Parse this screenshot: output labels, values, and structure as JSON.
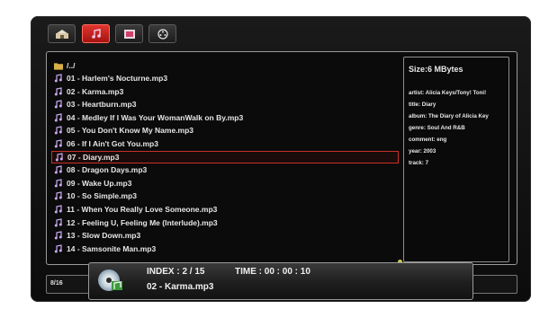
{
  "tabs": [
    {
      "name": "photo-tab",
      "icon": "photo-icon",
      "active": false
    },
    {
      "name": "music-tab",
      "icon": "music-note-icon",
      "active": true
    },
    {
      "name": "video-tab",
      "icon": "film-icon",
      "active": false
    },
    {
      "name": "all-media-tab",
      "icon": "reel-icon",
      "active": false
    }
  ],
  "list": {
    "parent": "/../",
    "items": [
      "01 - Harlem's Nocturne.mp3",
      "02 - Karma.mp3",
      "03 - Heartburn.mp3",
      "04 - Medley If I Was Your WomanWalk on By.mp3",
      "05 - You Don't Know My Name.mp3",
      "06 - If I Ain't Got You.mp3",
      "07 - Diary.mp3",
      "08 - Dragon Days.mp3",
      "09 - Wake Up.mp3",
      "10 - So Simple.mp3",
      "11 - When You Really Love Someone.mp3",
      "12 - Feeling U, Feeling Me (Interlude).mp3",
      "13 - Slow Down.mp3",
      "14 - Samsonite Man.mp3"
    ],
    "selected_index": 6
  },
  "info": {
    "size": "Size:6 MBytes",
    "artist": "artist: Alicia Keys/Tony! Toni!",
    "title": "title: Diary",
    "album": "album: The Diary of Alicia Key",
    "genre": "genre: Soul And R&B",
    "comment": "comment: eng",
    "year": "year: 2003",
    "track": "track: 7"
  },
  "footer": {
    "count": "8/16"
  },
  "now_playing": {
    "index": "INDEX :  2 / 15",
    "time": "TIME :  00 : 00 : 10",
    "track": "02 - Karma.mp3"
  },
  "colors": {
    "accent": "#c9302a",
    "note": "#c9aaf0",
    "folder": "#d8b048"
  }
}
